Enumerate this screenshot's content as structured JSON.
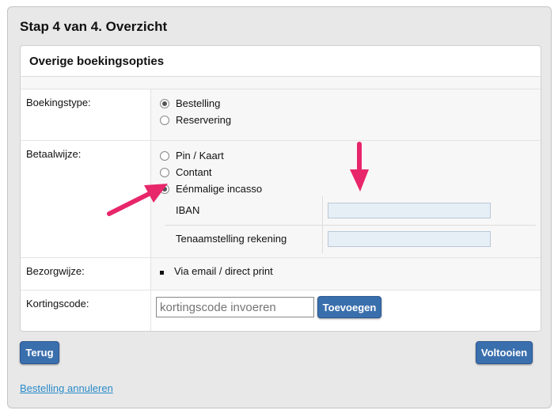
{
  "step_title": "Stap 4 van 4. Overzicht",
  "panel_title": "Overige boekingsopties",
  "boekingstype": {
    "label": "Boekingstype:",
    "options": [
      {
        "label": "Bestelling",
        "selected": true
      },
      {
        "label": "Reservering",
        "selected": false
      }
    ]
  },
  "betaalwijze": {
    "label": "Betaalwijze:",
    "options": [
      {
        "label": "Pin / Kaart",
        "selected": false
      },
      {
        "label": "Contant",
        "selected": false
      },
      {
        "label": "Eénmalige incasso",
        "selected": true
      }
    ],
    "iban_label": "IBAN",
    "iban_value": "",
    "tenaam_label": "Tenaamstelling rekening",
    "tenaam_value": ""
  },
  "bezorgwijze": {
    "label": "Bezorgwijze:",
    "value": "Via email / direct print"
  },
  "kortingscode": {
    "label": "Kortingscode:",
    "placeholder": "kortingscode invoeren",
    "add_button": "Toevoegen"
  },
  "buttons": {
    "back": "Terug",
    "finish": "Voltooien"
  },
  "cancel_link": "Bestelling annuleren",
  "colors": {
    "button": "#3a6fad",
    "arrow": "#e8266a",
    "link": "#2a8bc9"
  }
}
